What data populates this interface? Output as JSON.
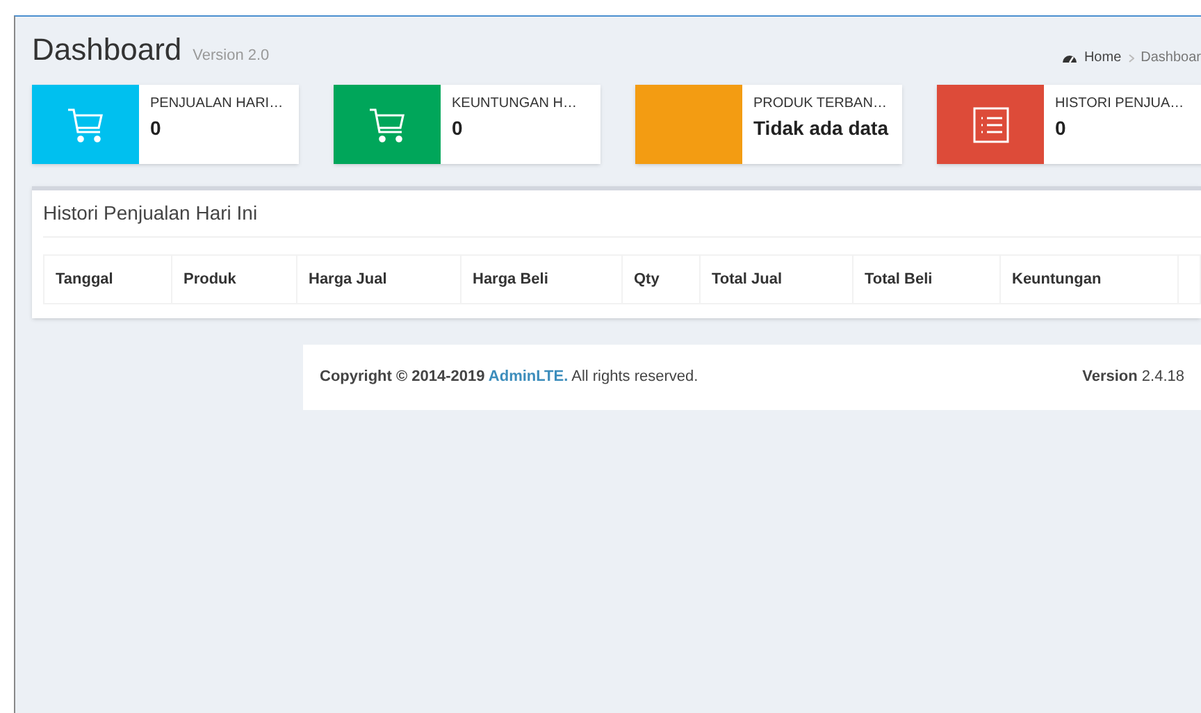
{
  "header": {
    "title": "Dashboard",
    "subtitle": "Version 2.0"
  },
  "breadcrumb": [
    {
      "label": "Home",
      "kind": "home"
    },
    {
      "label": "Dashboar",
      "kind": "page"
    }
  ],
  "info_boxes": [
    {
      "label": "PENJUALAN HARI…",
      "value": "0",
      "color": "#00c0ef",
      "kind": "cart"
    },
    {
      "label": "KEUNTUNGAN H…",
      "value": "0",
      "color": "#00a65a",
      "kind": "cart"
    },
    {
      "label": "PRODUK TERBAN…",
      "value": "Tidak ada data",
      "color": "#f39c12",
      "kind": "blank"
    },
    {
      "label": "HISTORI PENJUA…",
      "value": "0",
      "color": "#dd4b39",
      "kind": "list"
    }
  ],
  "panel": {
    "title": "Histori Penjualan Hari Ini",
    "columns": [
      "Tanggal",
      "Produk",
      "Harga Jual",
      "Harga Beli",
      "Qty",
      "Total Jual",
      "Total Beli",
      "Keuntungan"
    ]
  },
  "footer": {
    "copyright": "Copyright © 2014-2019",
    "link": "AdminLTE.",
    "rights": "All rights reserved.",
    "version": "**Version** 2.4.18"
  }
}
